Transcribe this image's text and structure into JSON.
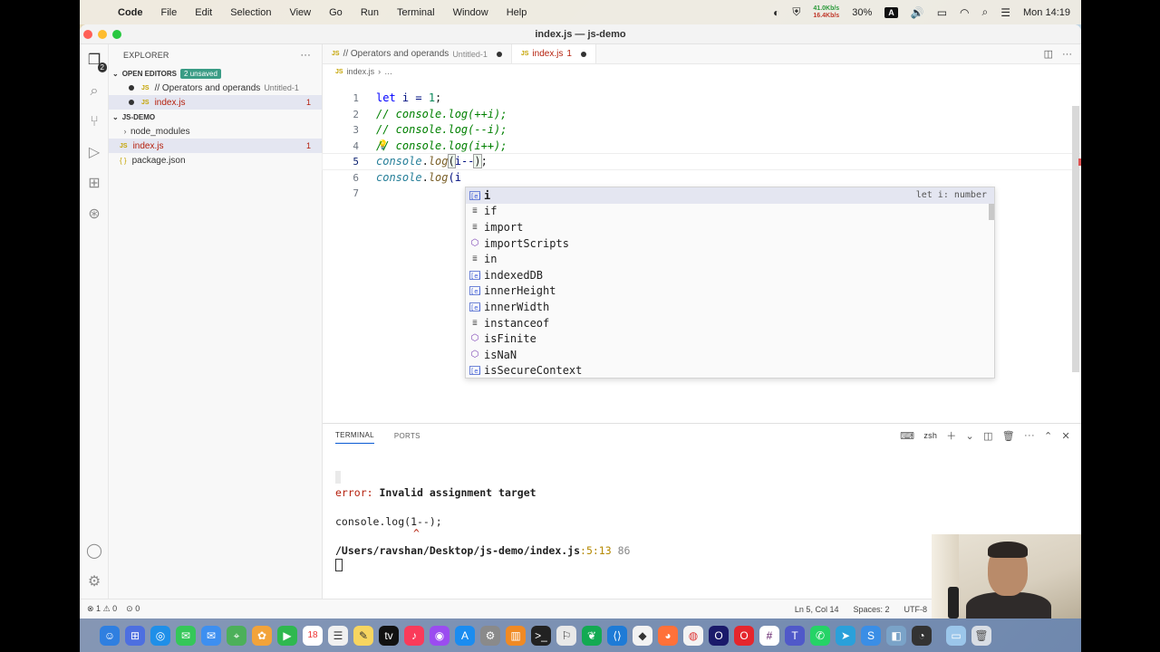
{
  "menubar": {
    "app": "Code",
    "items": [
      "File",
      "Edit",
      "Selection",
      "View",
      "Go",
      "Run",
      "Terminal",
      "Window",
      "Help"
    ],
    "net_up": "41.0Kb/s",
    "net_down": "16.4Kb/s",
    "battery": "30%",
    "input_source": "A",
    "clock": "Mon 14:19"
  },
  "window": {
    "title": "index.js — js-demo"
  },
  "activity_bar": {
    "explorer_badge": "2"
  },
  "sidebar": {
    "header": "EXPLORER",
    "more": "···",
    "open_editors": {
      "label": "OPEN EDITORS",
      "badge": "2 unsaved"
    },
    "open_items": [
      {
        "name": "// Operators and operands",
        "desc": "Untitled-1"
      },
      {
        "name": "index.js",
        "count": "1"
      }
    ],
    "project": "JS-DEMO",
    "files": [
      {
        "name": "node_modules"
      },
      {
        "name": "index.js",
        "count": "1"
      },
      {
        "name": "package.json"
      }
    ]
  },
  "tabs": [
    {
      "label": "// Operators and operands",
      "desc": "Untitled-1"
    },
    {
      "label": "index.js",
      "count": "1"
    }
  ],
  "breadcrumb": {
    "file": "index.js",
    "more": "…"
  },
  "code": {
    "line_numbers": [
      "1",
      "2",
      "3",
      "4",
      "5",
      "6",
      "7"
    ],
    "l1": {
      "kw": "let",
      "rest": " i = ",
      "num": "1",
      "end": ";"
    },
    "l2": "// console.log(++i);",
    "l3": "// console.log(--i);",
    "l4": "// console.log(i++);",
    "l5": {
      "obj": "console",
      "dot": ".",
      "fn": "log",
      "open": "(",
      "arg": "i--",
      "close": ")",
      "end": ";"
    },
    "l6": {
      "obj": "console",
      "dot": ".",
      "fn": "log",
      "rest": "(i"
    }
  },
  "suggest": {
    "items": [
      {
        "label": "i",
        "kind": "variable",
        "detail": "let i: number"
      },
      {
        "label": "if",
        "kind": "keyword"
      },
      {
        "label": "import",
        "kind": "keyword"
      },
      {
        "label": "importScripts",
        "kind": "method"
      },
      {
        "label": "in",
        "kind": "keyword"
      },
      {
        "label": "indexedDB",
        "kind": "variable"
      },
      {
        "label": "innerHeight",
        "kind": "variable"
      },
      {
        "label": "innerWidth",
        "kind": "variable"
      },
      {
        "label": "instanceof",
        "kind": "keyword"
      },
      {
        "label": "isFinite",
        "kind": "method"
      },
      {
        "label": "isNaN",
        "kind": "method"
      },
      {
        "label": "isSecureContext",
        "kind": "variable"
      }
    ]
  },
  "panel": {
    "tabs": [
      "TERMINAL",
      "PORTS"
    ],
    "shell": "zsh",
    "terminal": {
      "error_label": "error:",
      "error_msg": " Invalid assignment target",
      "code_line": "console.log(1--);",
      "caret": "^",
      "path": "/Users/ravshan/Desktop/js-demo/index.js",
      "pos": ":5:13",
      "line_no": "86"
    }
  },
  "status": {
    "errors": "1",
    "warnings": "0",
    "ports": "0",
    "cursor": "Ln 5, Col 14",
    "spaces": "Spaces: 2",
    "encoding": "UTF-8"
  },
  "dock": {
    "calendar_day": "18"
  },
  "colors": {
    "accent": "#0b5bd3",
    "error": "#b5200d",
    "badge": "#3a9c85"
  }
}
